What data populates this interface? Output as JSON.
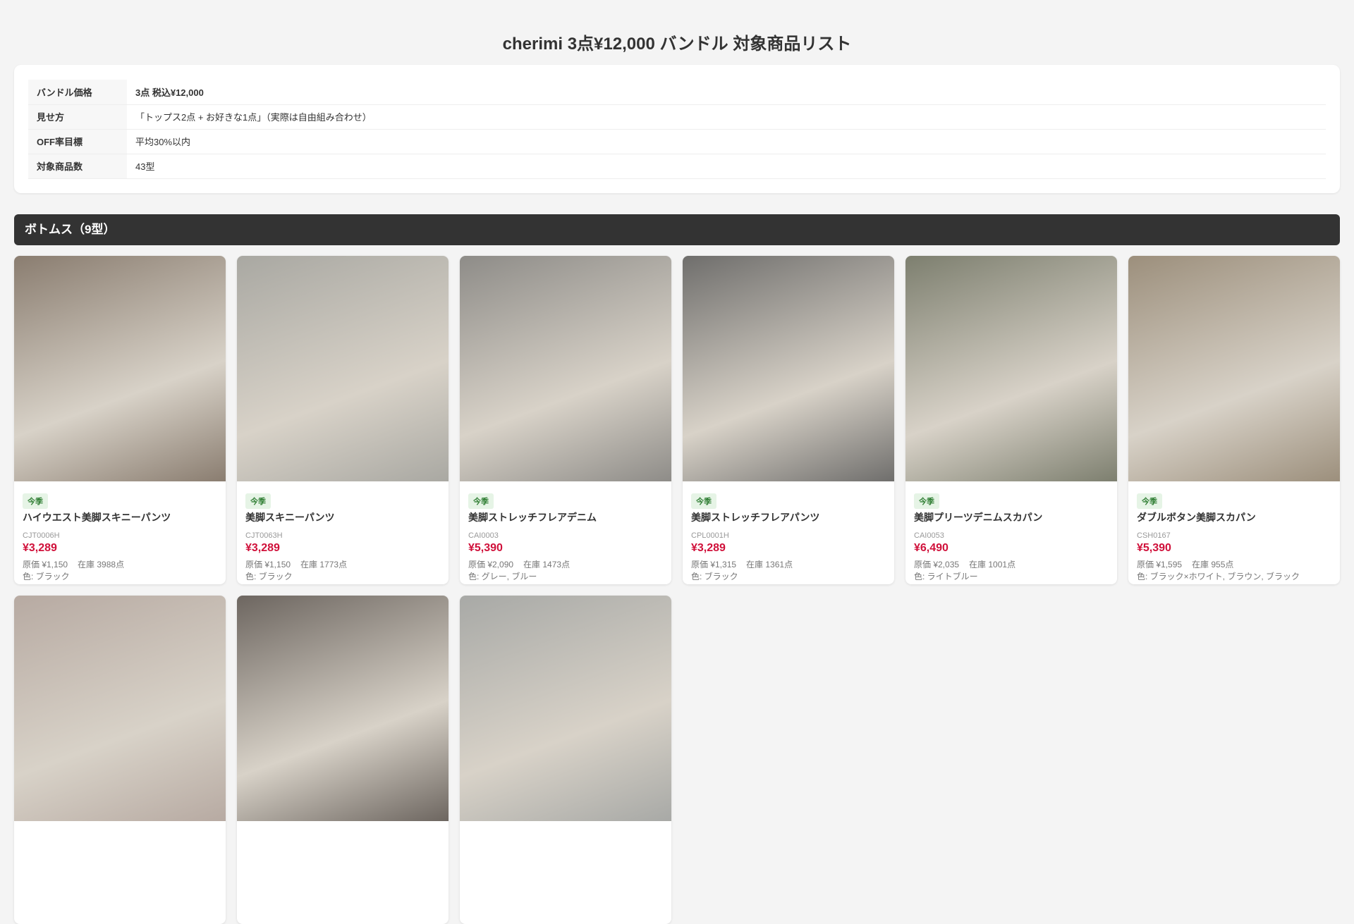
{
  "title": "cherimi 3点¥12,000 バンドル 対象商品リスト",
  "info": [
    {
      "k": "バンドル価格",
      "v": "3点 税込¥12,000"
    },
    {
      "k": "見せ方",
      "v": "「トップス2点 + お好きな1点」（実際は自由組み合わせ）"
    },
    {
      "k": "OFF率目標",
      "v": "平均30%以内"
    },
    {
      "k": "対象商品数",
      "v": "43型"
    }
  ],
  "section": "ボトムス（9型）",
  "products": [
    {
      "badge": "今季",
      "name": "ハイウエスト美脚スキニーパンツ",
      "sku": "CJT0006H",
      "price": "¥3,289",
      "cost": "原価 ¥1,150",
      "stock": "在庫 3988点",
      "color": "色: ブラック",
      "bg": "#8a7d70"
    },
    {
      "badge": "今季",
      "name": "美脚スキニーパンツ",
      "sku": "CJT0063H",
      "price": "¥3,289",
      "cost": "原価 ¥1,150",
      "stock": "在庫 1773点",
      "color": "色: ブラック",
      "bg": "#a9a8a2"
    },
    {
      "badge": "今季",
      "name": "美脚ストレッチフレアデニム",
      "sku": "CAI0003",
      "price": "¥5,390",
      "cost": "原価 ¥2,090",
      "stock": "在庫 1473点",
      "color": "色: グレー, ブルー",
      "bg": "#8e8c88"
    },
    {
      "badge": "今季",
      "name": "美脚ストレッチフレアパンツ",
      "sku": "CPL0001H",
      "price": "¥3,289",
      "cost": "原価 ¥1,315",
      "stock": "在庫 1361点",
      "color": "色: ブラック",
      "bg": "#6f6e6c"
    },
    {
      "badge": "今季",
      "name": "美脚プリーツデニムスカパン",
      "sku": "CAI0053",
      "price": "¥6,490",
      "cost": "原価 ¥2,035",
      "stock": "在庫 1001点",
      "color": "色: ライトブルー",
      "bg": "#7d7f6f"
    },
    {
      "badge": "今季",
      "name": "ダブルボタン美脚スカパン",
      "sku": "CSH0167",
      "price": "¥5,390",
      "cost": "原価 ¥1,595",
      "stock": "在庫 955点",
      "color": "色: ブラック×ホワイト, ブラウン, ブラック",
      "bg": "#9c8f7c"
    },
    {
      "bg": "#b7aaa2"
    },
    {
      "bg": "#6d6660"
    },
    {
      "bg": "#a8a9a6"
    }
  ]
}
